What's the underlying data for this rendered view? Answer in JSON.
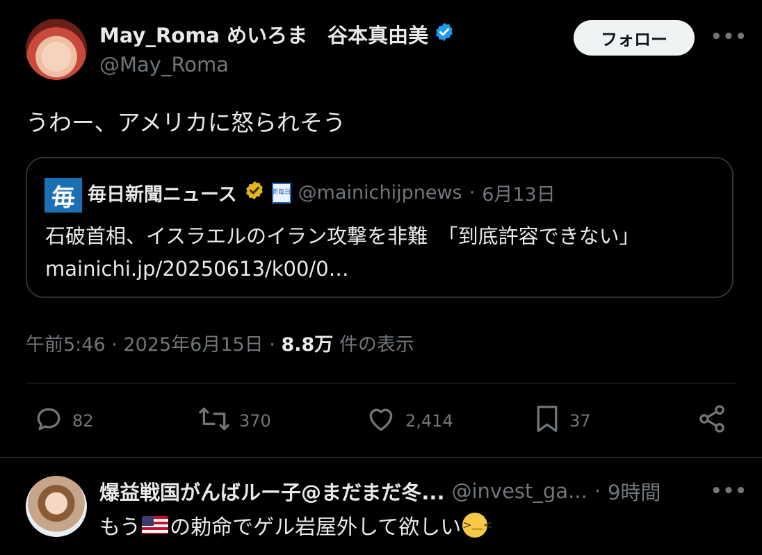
{
  "tweet": {
    "author": {
      "display_name": "May_Roma めいろま　谷本真由美",
      "handle": "@May_Roma",
      "verified_color": "#1d9bf0"
    },
    "follow_label": "フォロー",
    "more": "•••",
    "text": "うわー、アメリカに怒られそう",
    "quote": {
      "logo_glyph": "毎",
      "name": "毎日新聞ニュース",
      "verified_color": "#e2b719",
      "affiliate_glyph": "新毎日",
      "handle": "@mainichijpnews",
      "separator": "·",
      "date": "6月13日",
      "text": "石破首相、イスラエルのイラン攻撃を非難　「到底許容できない」 mainichi.jp/20250613/k00/0…"
    },
    "meta": {
      "time": "午前5:46",
      "sep1": "·",
      "date": "2025年6月15日",
      "sep2": "·",
      "views_count": "8.8万",
      "views_label": "件の表示"
    },
    "actions": {
      "replies": "82",
      "retweets": "370",
      "likes": "2,414",
      "bookmarks": "37"
    }
  },
  "reply": {
    "name": "爆益戦国がんばルー子@まだまだ冬...",
    "handle": "@invest_ga...",
    "separator": "·",
    "time": "9時間",
    "more": "•••",
    "text_before": "もう",
    "flag_icon": "us-flag-icon",
    "text_after": "の勅命でゲル岩屋外して欲しい",
    "emoji_icon": "weary-face-icon"
  },
  "colors": {
    "background": "#000000",
    "text": "#e7e9ea",
    "muted": "#71767b",
    "border": "#2f3336"
  }
}
